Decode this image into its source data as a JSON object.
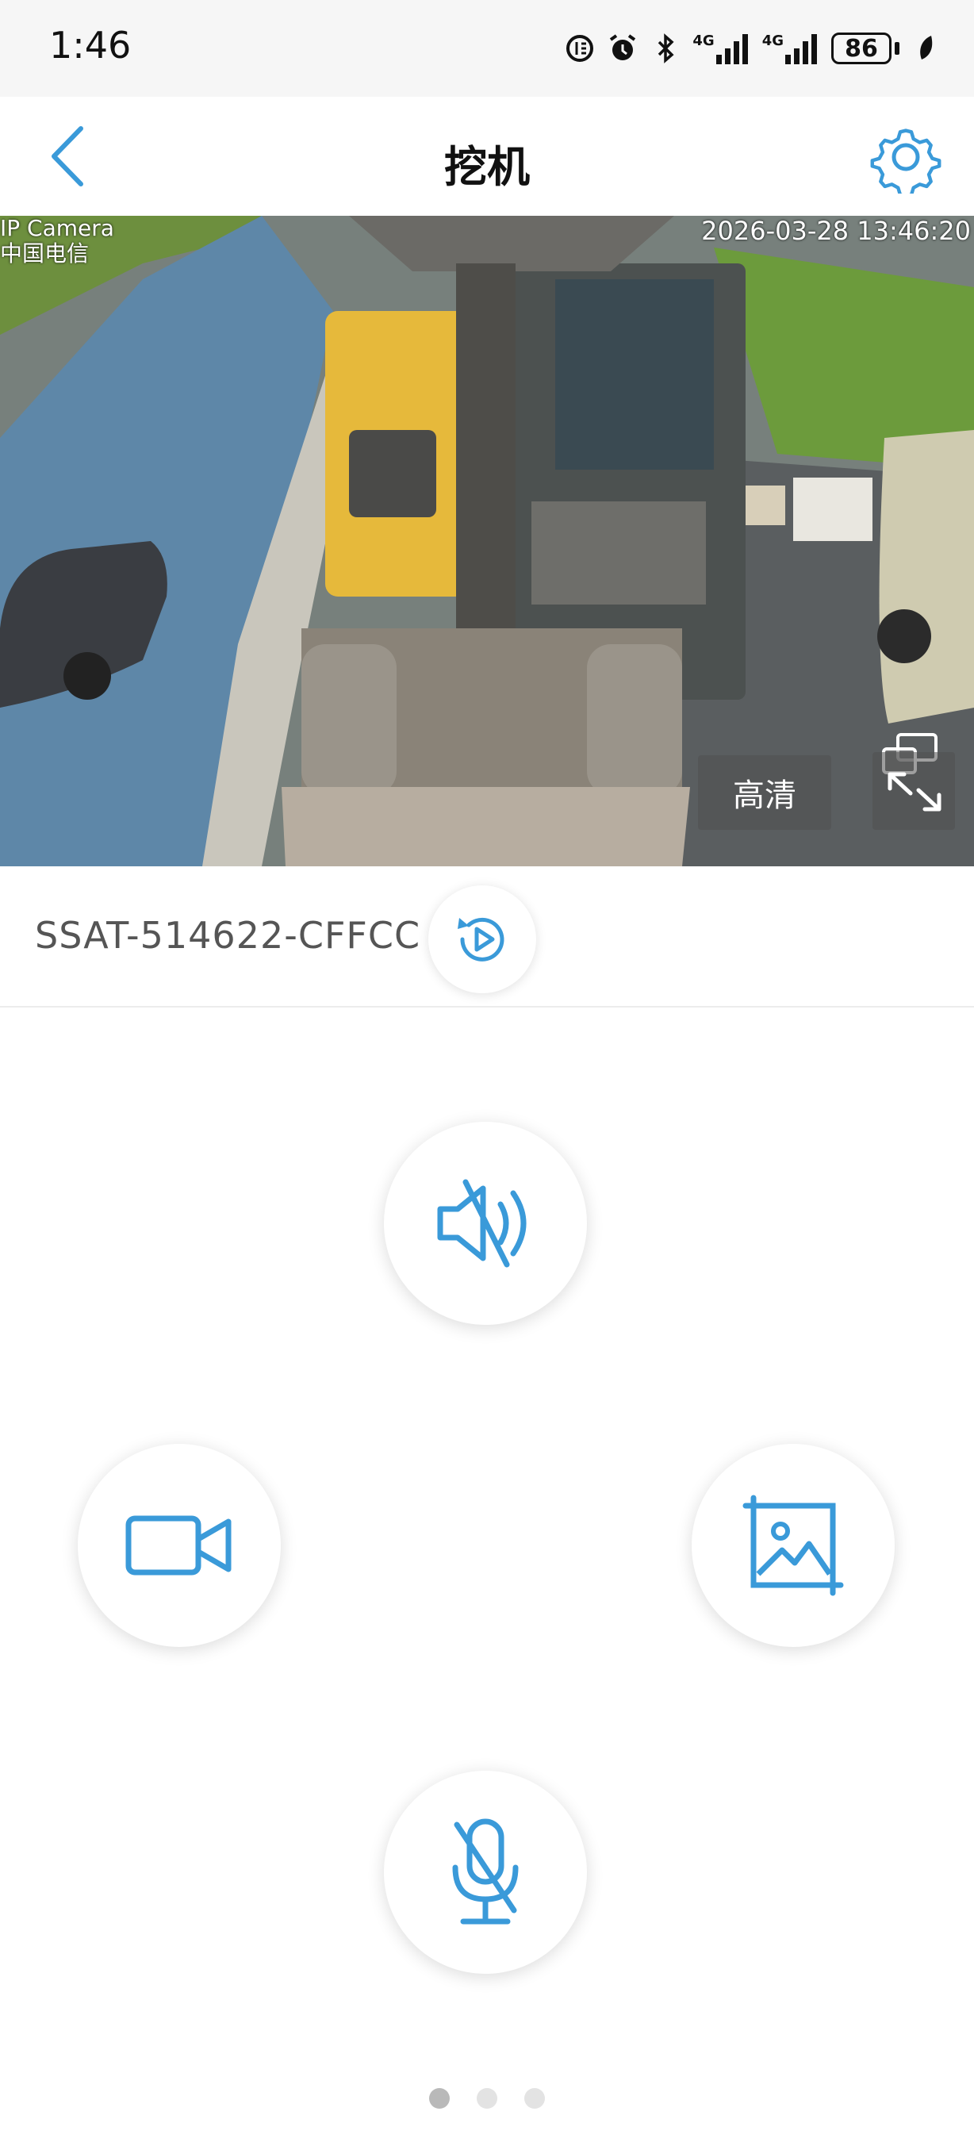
{
  "status_bar": {
    "time": "1:46",
    "signal1_label": "4G",
    "signal2_label": "4G",
    "battery": "86"
  },
  "nav": {
    "title": "挖机",
    "accent_color": "#3a9ad9"
  },
  "video": {
    "osd_top_left_1": "IP Camera",
    "osd_top_left_2": "中国电信 ",
    "osd_timestamp": "2026-03-28 13:46:20",
    "quality_label": "高清"
  },
  "device": {
    "id": "SSAT-514622-CFFCC"
  },
  "controls": [
    {
      "name": "mute-audio",
      "icon": "speaker-muted-icon"
    },
    {
      "name": "record-video",
      "icon": "video-camera-icon"
    },
    {
      "name": "snapshot",
      "icon": "image-icon"
    },
    {
      "name": "talk",
      "icon": "microphone-off-icon"
    }
  ],
  "pager": {
    "pages": 3,
    "active": 1
  }
}
